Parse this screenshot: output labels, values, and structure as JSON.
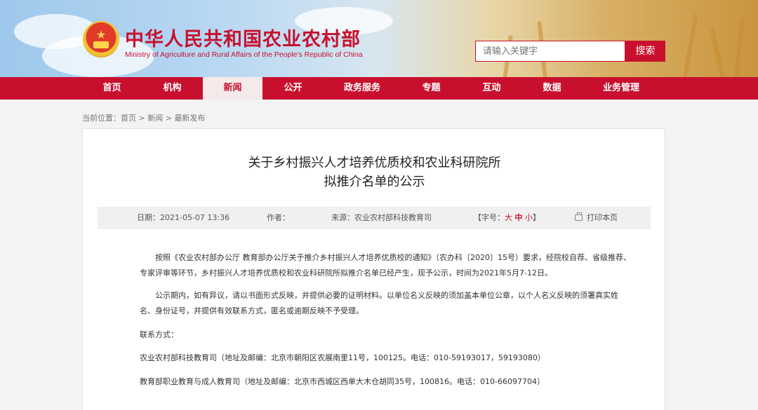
{
  "site": {
    "title": "中华人民共和国农业农村部",
    "subtitle": "Ministry of Agriculture and Rural Affairs of the People's Republic of China"
  },
  "search": {
    "placeholder": "请输入关键字",
    "button": "搜索"
  },
  "nav": {
    "items": [
      "首页",
      "机构",
      "新闻",
      "公开",
      "政务服务",
      "专题",
      "互动",
      "数据",
      "业务管理"
    ],
    "active": "新闻"
  },
  "breadcrumb": {
    "prefix": "当前位置：",
    "home": "首页",
    "sep1": " > ",
    "section": "新闻",
    "sep2": " > ",
    "current": "最新发布"
  },
  "article": {
    "title_line1": "关于乡村振兴人才培养优质校和农业科研院所",
    "title_line2": "拟推介名单的公示",
    "meta": {
      "date": "日期：2021-05-07 13:36",
      "author": "作者：",
      "source": "来源：农业农村部科技教育司",
      "font_open": "【字号：",
      "font_large": "大",
      "font_medium": "中",
      "font_small": "小",
      "font_close": "】",
      "print": "打印本页"
    },
    "paragraphs": [
      "按照《农业农村部办公厅 教育部办公厅关于推介乡村振兴人才培养优质校的通知》（农办科〔2020〕15号）要求，经院校自荐、省级推荐、专家评审等环节，乡村振兴人才培养优质校和农业科研院所拟推介名单已经产生，现予公示，时间为2021年5月7-12日。",
      "公示期内，如有异议，请以书面形式反映，并提供必要的证明材料。以单位名义反映的须加盖本单位公章，以个人名义反映的须署真实姓名、身份证号，并提供有效联系方式，匿名或逾期反映不予受理。",
      "联系方式：",
      "农业农村部科技教育司（地址及邮编：北京市朝阳区农展南里11号，100125。电话：010-59193017，59193080）",
      "教育部职业教育与成人教育司（地址及邮编：北京市西城区西单大木仓胡同35号，100816。电话：010-66097704）"
    ]
  },
  "colors": {
    "brand_red": "#c8102e",
    "nav_active_bg": "#f5eaea"
  }
}
